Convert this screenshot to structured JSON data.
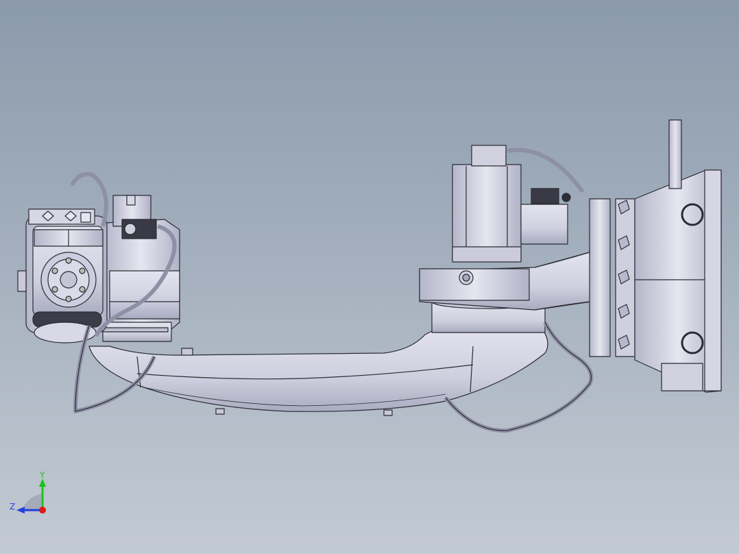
{
  "view": {
    "background_top": "#8b9aab",
    "background_bottom": "#c3cad3",
    "model_fill": "#d6d6e4",
    "model_shade": "#aeb0c4",
    "edge_color": "#2a2a32"
  },
  "triad": {
    "y_label": "Y",
    "z_label": "Z",
    "y_color": "#18c418",
    "z_color": "#2040e0",
    "x_color": "#e01818"
  }
}
